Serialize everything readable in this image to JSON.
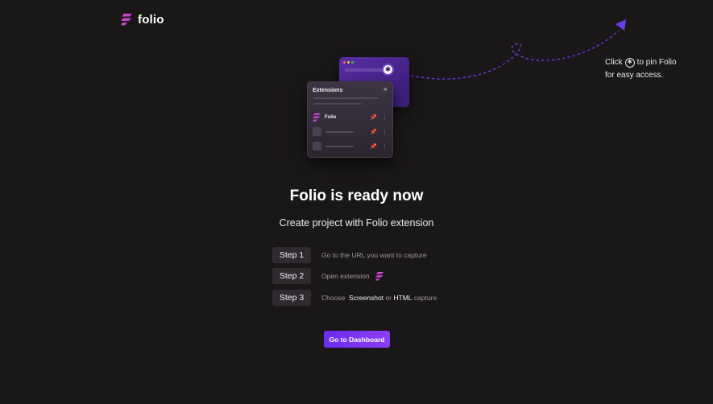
{
  "brand": {
    "name": "folio",
    "accent": "#7a35f5"
  },
  "pin_tip": {
    "prefix": "Click",
    "icon": "puzzle-icon",
    "suffix": "to pin Folio",
    "line2": "for easy access."
  },
  "illustration": {
    "panel_title": "Extensions",
    "close_glyph": "×",
    "extension_name": "Folio"
  },
  "headline": "Folio is ready now",
  "subhead": "Create project with Folio extension",
  "steps": [
    {
      "label": "Step 1",
      "text": "Go to the URL you want to capture"
    },
    {
      "label": "Step 2",
      "text": "Open extension"
    },
    {
      "label": "Step 3",
      "prefix": "Choose",
      "option1": "Screenshot",
      "or": "or",
      "option2": "HTML",
      "suffix": "capture"
    }
  ],
  "cta": {
    "label": "Go to Dashboard"
  }
}
